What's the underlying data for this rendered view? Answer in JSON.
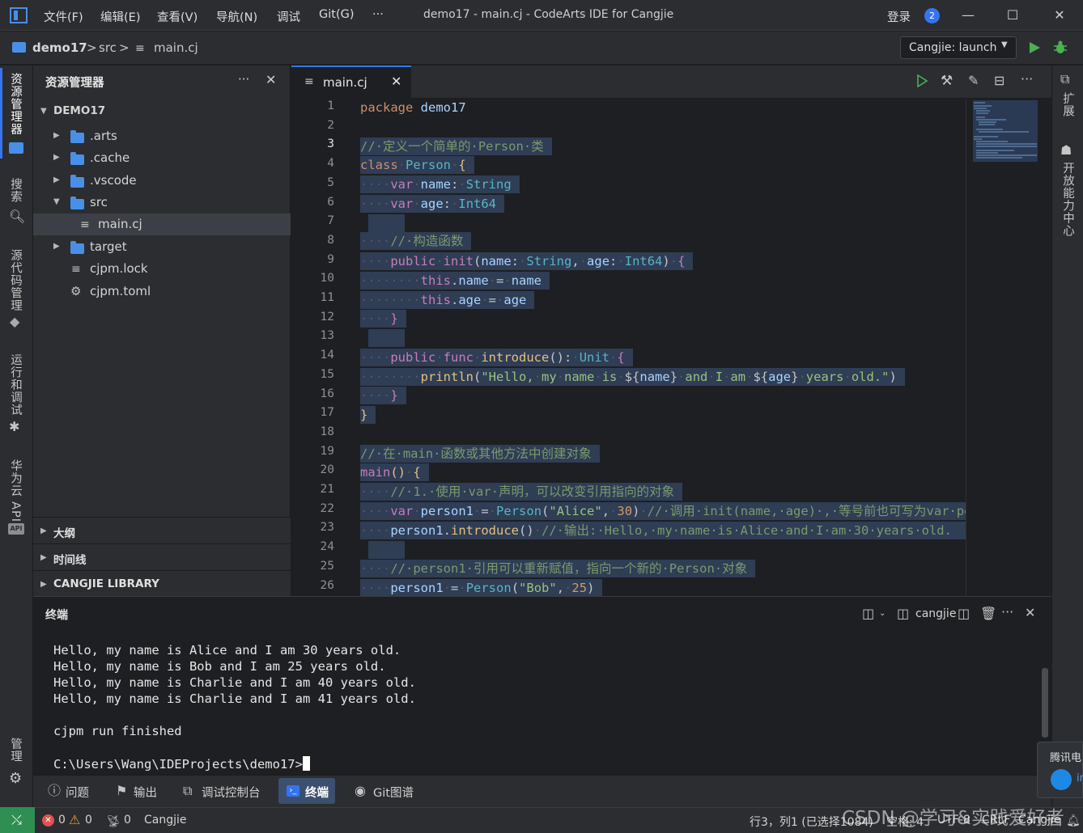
{
  "titlebar": {
    "menus": [
      "文件(F)",
      "编辑(E)",
      "查看(V)",
      "导航(N)",
      "调试",
      "Git(G)",
      "···"
    ],
    "title": "demo17 - main.cj - CodeArts IDE for Cangjie",
    "login": "登录",
    "notification_count": "2"
  },
  "breadcrumb": {
    "project": "demo17",
    "sep": ">",
    "folder": "src",
    "file": "main.cj",
    "run_config": "Cangjie: launch"
  },
  "activity": {
    "explorer": "资源管理器",
    "search": "搜索",
    "scm": "源代码管理",
    "run_debug": "运行和调试",
    "cloud_api": "华为云 API",
    "api_badge": "API",
    "manage": "管理"
  },
  "rightbar": {
    "extensions": "扩展",
    "open_center": "开放能力中心"
  },
  "sidebar": {
    "title": "资源管理器",
    "more": "···",
    "root": "DEMO17",
    "items": [
      {
        "label": ".arts",
        "kind": "folder"
      },
      {
        "label": ".cache",
        "kind": "folder"
      },
      {
        "label": ".vscode",
        "kind": "folder"
      },
      {
        "label": "src",
        "kind": "folder-open"
      },
      {
        "label": "main.cj",
        "kind": "file"
      },
      {
        "label": "target",
        "kind": "folder"
      },
      {
        "label": "cjpm.lock",
        "kind": "file"
      },
      {
        "label": "cjpm.toml",
        "kind": "gear-file"
      }
    ],
    "sections": [
      "大纲",
      "时间线",
      "CANGJIE LIBRARY"
    ]
  },
  "editor": {
    "tab_label": "main.cj",
    "current_line": 3,
    "line_numbers": [
      "1",
      "2",
      "3",
      "4",
      "5",
      "6",
      "7",
      "8",
      "9",
      "10",
      "11",
      "12",
      "13",
      "14",
      "15",
      "16",
      "17",
      "18",
      "19",
      "20",
      "21",
      "22",
      "23",
      "24",
      "25",
      "26"
    ]
  },
  "terminal": {
    "title": "终端",
    "shell_label": "cangjie",
    "lines": [
      "Hello, my name is Alice and I am 30 years old.",
      "Hello, my name is Bob and I am 25 years old.",
      "Hello, my name is Charlie and I am 40 years old.",
      "Hello, my name is Charlie and I am 41 years old.",
      "",
      "cjpm run finished",
      ""
    ],
    "prompt": "C:\\Users\\Wang\\IDEProjects\\demo17>"
  },
  "panel_tabs": [
    "问题",
    "输出",
    "调试控制台",
    "终端",
    "Git图谱"
  ],
  "statusbar": {
    "errors": "0",
    "warnings": "0",
    "ports": "0",
    "language": "Cangjie",
    "position": "行3，列1 (已选择1084)",
    "spaces": "空格: 4",
    "encoding": "UTF-8",
    "eol": "CRLF",
    "lang_mode": "Cangjie"
  },
  "popup": {
    "text": "腾讯电",
    "sub": "in"
  },
  "watermark": "CSDN @学习&实践爱好者",
  "colors": {
    "accent": "#3574f0",
    "selection": "#2f3d55",
    "run_green": "#4caf50",
    "remote_green": "#2f8f53",
    "error_red": "#e05252",
    "warning_yellow": "#e0a030"
  }
}
